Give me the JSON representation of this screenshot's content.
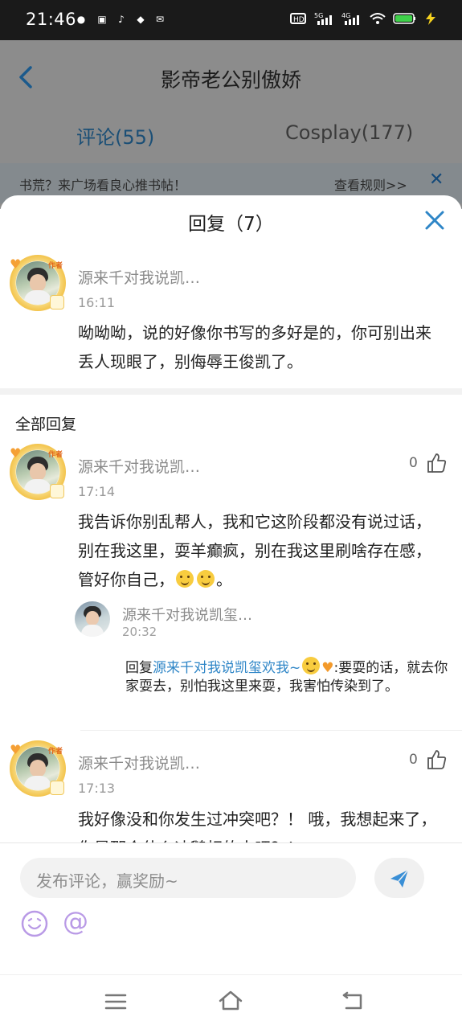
{
  "status_bar": {
    "time": "21:46",
    "indicators": [
      "HD",
      "5G",
      "4G",
      "wifi",
      "battery"
    ]
  },
  "background_page": {
    "title": "影帝老公别傲娇",
    "tabs": [
      {
        "label": "评论(55)",
        "active": true
      },
      {
        "label": "Cosplay(177)",
        "active": false
      }
    ],
    "notice": {
      "text": "书荒？来广场看良心推书帖！",
      "link": "查看规则>>"
    }
  },
  "sheet": {
    "title": "回复（7）",
    "main_comment": {
      "user": "源来千对我说凯…",
      "badge": "作者",
      "time": "16:11",
      "text": "呦呦呦，说的好像你书写的多好是的，你可别出来丢人现眼了，别侮辱王俊凯了。"
    },
    "all_replies_label": "全部回复",
    "replies": [
      {
        "user": "源来千对我说凯…",
        "badge": "作者",
        "time": "17:14",
        "likes": "0",
        "text_before": "我告诉你别乱帮人，我和它这阶段都没有说过话，别在我这里，耍羊癫疯，别在我这里刷啥存在感，管好你自己，",
        "text_after": "。",
        "sub_reply": {
          "user": "源来千对我说凯玺…",
          "time": "20:32",
          "prefix": "回复",
          "link_user": "源来千对我说凯玺欢我~",
          "text": ":要耍的话，就去你家耍去，别怕我这里来耍，我害怕传染到了。"
        }
      },
      {
        "user": "源来千对我说凯…",
        "badge": "作者",
        "time": "17:13",
        "likes": "0",
        "text": "我好像没和你发生过冲突吧？！ 哦，我想起来了，你是那个什么迪鹅相的人吧？！"
      }
    ]
  },
  "input_bar": {
    "placeholder": "发布评论，赢奖励~",
    "at_symbol": "@"
  },
  "colors": {
    "accent": "#2f86c7",
    "dim_overlay": "#8c8c8c",
    "send_icon": "#3a8fd6"
  }
}
